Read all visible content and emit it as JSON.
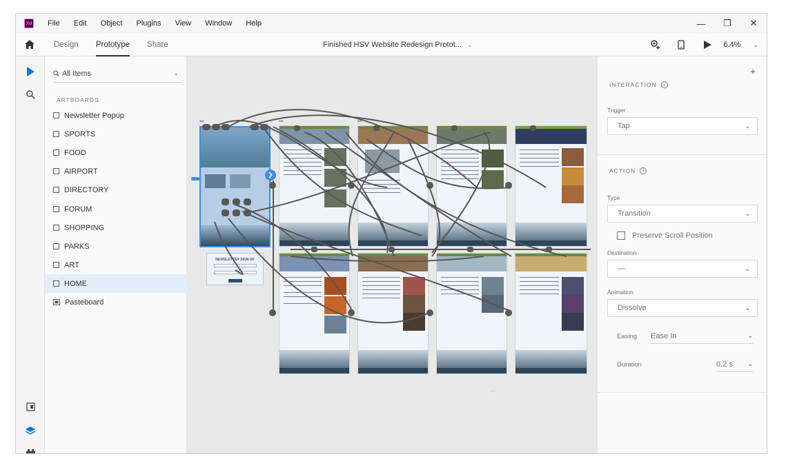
{
  "app": {
    "logo_text": "Xd"
  },
  "menu": [
    "File",
    "Edit",
    "Object",
    "Plugins",
    "View",
    "Window",
    "Help"
  ],
  "window_controls": {
    "minimize": "—",
    "restore": "❐",
    "close": "✕"
  },
  "modes": {
    "design": "Design",
    "prototype": "Prototype",
    "share": "Share",
    "active": "prototype"
  },
  "document": {
    "title": "Finished HSV Website Redesign Protot..."
  },
  "zoom": {
    "value": "6.4%"
  },
  "layers": {
    "search_label": "All Items",
    "section": "ARTBOARDS",
    "items": [
      {
        "label": "Newsletter Popup",
        "type": "artboard"
      },
      {
        "label": "SPORTS",
        "type": "artboard"
      },
      {
        "label": "FOOD",
        "type": "artboard"
      },
      {
        "label": "AIRPORT",
        "type": "artboard"
      },
      {
        "label": "DIRECTORY",
        "type": "artboard"
      },
      {
        "label": "FORUM",
        "type": "artboard"
      },
      {
        "label": "SHOPPING",
        "type": "artboard"
      },
      {
        "label": "PARKS",
        "type": "artboard"
      },
      {
        "label": "ART",
        "type": "artboard"
      },
      {
        "label": "HOME",
        "type": "artboard",
        "selected": true
      },
      {
        "label": "Pasteboard",
        "type": "pasteboard"
      }
    ]
  },
  "canvas": {
    "popup_title": "NEWSLETTER SIGN UP",
    "more_dots": "•••",
    "scroll_indicator": "··"
  },
  "interaction": {
    "header": "INTERACTION",
    "trigger_label": "Trigger",
    "trigger_value": "Tap",
    "action_header": "ACTION",
    "type_label": "Type",
    "type_value": "Transition",
    "preserve_scroll_label": "Preserve Scroll Position",
    "preserve_scroll_checked": false,
    "destination_label": "Destination",
    "destination_value": "—",
    "animation_label": "Animation",
    "animation_value": "Dissolve",
    "easing_label": "Easing",
    "easing_value": "Ease In",
    "duration_label": "Duration",
    "duration_value": "0.2 s"
  },
  "colors": {
    "selection": "#3d8de0",
    "accent_xd": "#470137"
  }
}
